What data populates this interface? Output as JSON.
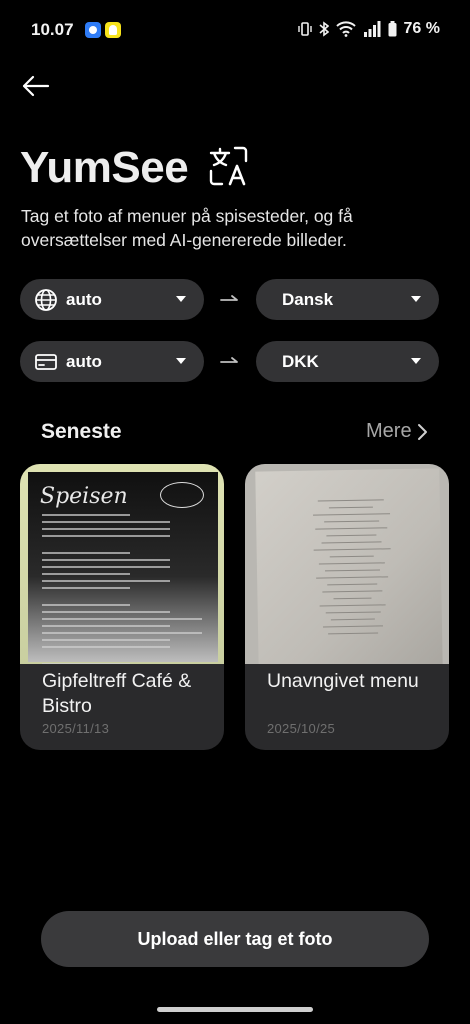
{
  "status_bar": {
    "time": "10.07",
    "battery": "76 %",
    "notifications": [
      "messenger-icon",
      "snapchat-icon"
    ],
    "system_icons": [
      "vibrate-icon",
      "bluetooth-icon",
      "wifi-icon",
      "signal-icon",
      "battery-icon"
    ]
  },
  "header": {
    "back_icon": "arrow-left-icon",
    "title": "YumSee",
    "title_icon": "translate-icon",
    "subtitle": "Tag et foto af menuer på spisesteder, og få oversættelser med AI-genererede billeder."
  },
  "selectors": {
    "language": {
      "icon": "globe-icon",
      "from": "auto",
      "to": "Dansk"
    },
    "currency": {
      "icon": "card-icon",
      "from": "auto",
      "to": "DKK"
    }
  },
  "recent": {
    "title": "Seneste",
    "more_label": "Mere",
    "items": [
      {
        "title": "Gipfeltreff Café & Bistro",
        "date": "2025/11/13",
        "thumb_text": "Speisen"
      },
      {
        "title": "Unavngivet menu",
        "date": "2025/10/25"
      }
    ]
  },
  "upload_label": "Upload eller tag et foto",
  "colors": {
    "background": "#000000",
    "pill": "#333335",
    "card": "#2a2a2c",
    "button": "#3a3a3c",
    "muted_text": "#a7a7a7"
  }
}
